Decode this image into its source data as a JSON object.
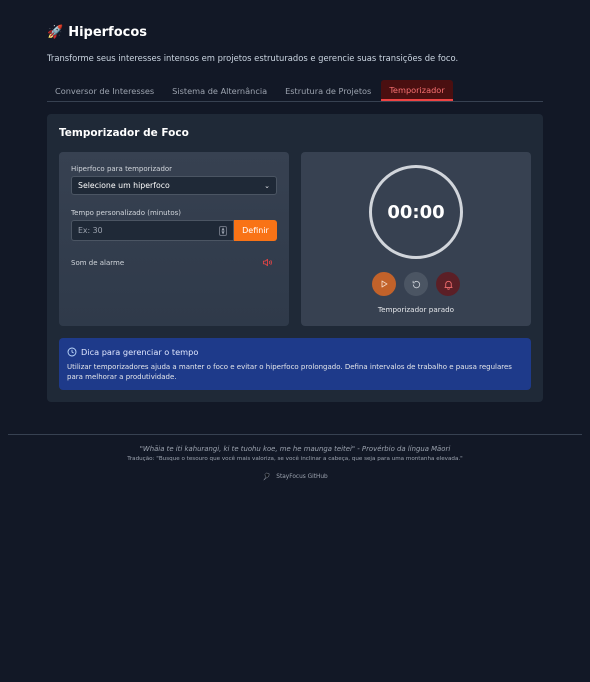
{
  "header": {
    "title": "Hiperfocos",
    "subtitle": "Transforme seus interesses intensos em projetos estruturados e gerencie suas transições de foco."
  },
  "tabs": [
    {
      "label": "Conversor de Interesses",
      "active": false
    },
    {
      "label": "Sistema de Alternância",
      "active": false
    },
    {
      "label": "Estrutura de Projetos",
      "active": false
    },
    {
      "label": "Temporizador",
      "active": true
    }
  ],
  "timer_panel": {
    "title": "Temporizador de Foco",
    "hyperfocus_label": "Hiperfoco para temporizador",
    "hyperfocus_select": "Selecione um hiperfoco",
    "custom_time_label": "Tempo personalizado (minutos)",
    "custom_time_placeholder": "Ex: 30",
    "define_button": "Definir",
    "alarm_label": "Som de alarme",
    "time_display": "00:00",
    "status": "Temporizador parado"
  },
  "tip": {
    "title": "Dica para gerenciar o tempo",
    "text": "Utilizar temporizadores ajuda a manter o foco e evitar o hiperfoco prolongado. Defina intervalos de trabalho e pausa regulares para melhorar a produtividade."
  },
  "footer": {
    "quote": "\"Whāia te iti kahurangi, ki te tuohu koe, me he maunga teitei\" - Provérbio da língua Māori",
    "translation": "Tradução: \"Busque o tesouro que você mais valoriza, se você inclinar a cabeça, que seja para uma montanha elevada.\"",
    "github_link": "StayFocus GitHub"
  },
  "colors": {
    "background": "#121826",
    "panel": "#1f2937",
    "card": "#374151",
    "accent_orange": "#f97316",
    "active_tab_bg": "#4a0f10",
    "active_tab_text": "#f87171",
    "tip_bg": "#1e3a8a"
  },
  "icons": {
    "title_icon": "rocket-icon",
    "alarm_icon": "speaker-icon",
    "tip_icon": "clock-icon",
    "play_icon": "play-icon",
    "reset_icon": "reset-icon",
    "bell_icon": "bell-icon",
    "github_icon": "github-icon"
  }
}
